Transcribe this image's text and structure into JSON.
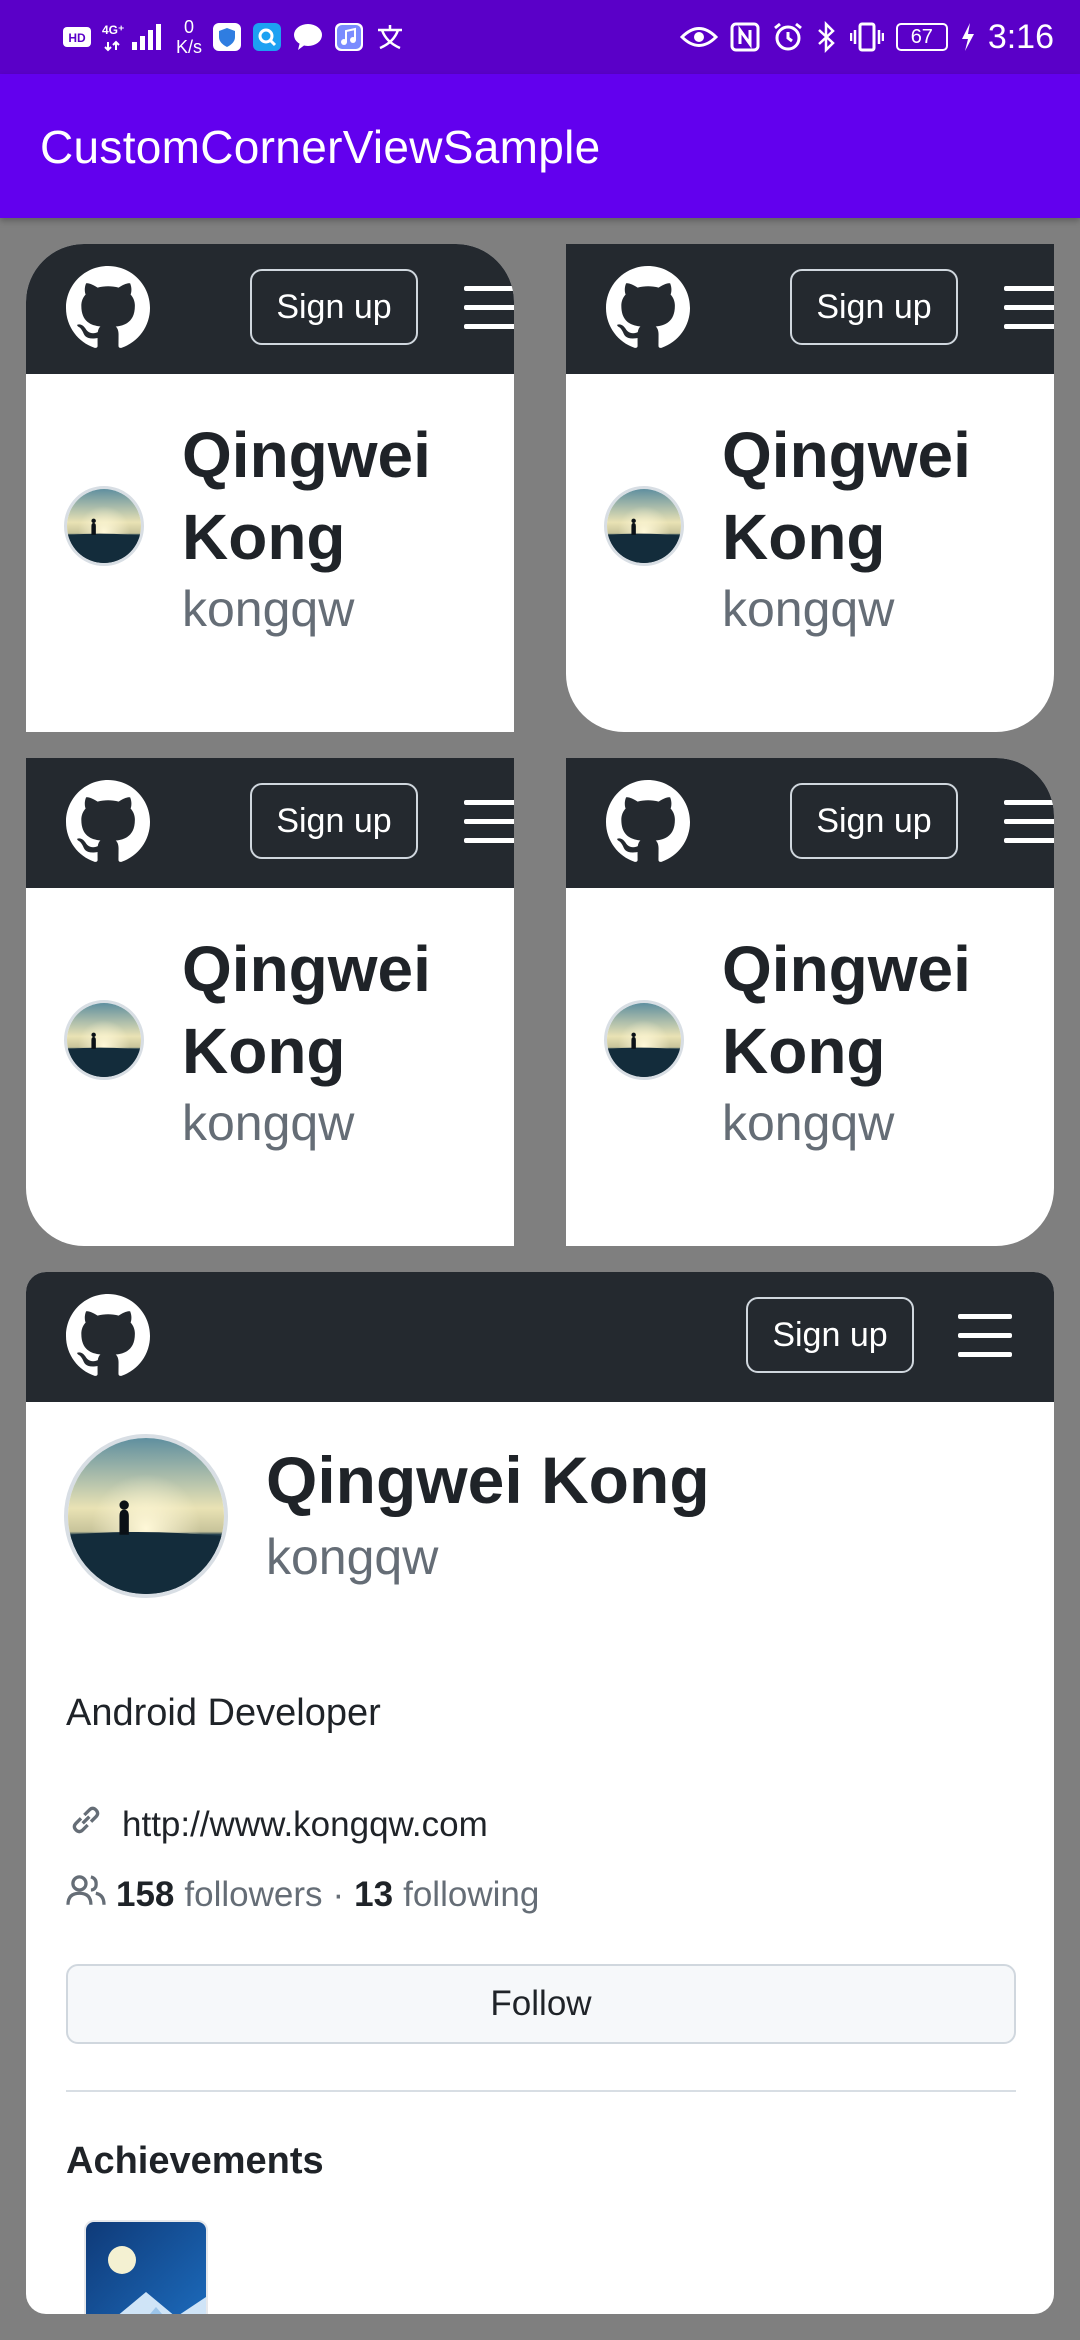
{
  "status_bar": {
    "left_icons": [
      "hd-icon",
      "signal-4g-icon",
      "shield-app-icon",
      "search-app-icon",
      "chat-bubble-icon",
      "music-app-icon",
      "translate-icon"
    ],
    "hd_label": "HD",
    "network_label": "4G⁺",
    "speed_value": "0",
    "speed_unit": "K/s",
    "battery": "67",
    "time": "3:16"
  },
  "app": {
    "title": "CustomCornerViewSample"
  },
  "profile": {
    "name": "Qingwei Kong",
    "name_line1": "Qingwei",
    "name_line2": "Kong",
    "login": "kongqw",
    "signup_label": "Sign up",
    "bio": "Android Developer",
    "website": "http://www.kongqw.com",
    "followers_count": "158",
    "followers_label": "followers",
    "separator": "·",
    "following_count": "13",
    "following_label": "following",
    "follow_label": "Follow",
    "achievements_title": "Achievements"
  },
  "colors": {
    "status_bar": "#5a00c8",
    "app_bar": "#6200ee",
    "background": "#7f7f7f",
    "card_header": "#24292f",
    "text_primary": "#1f2328",
    "text_secondary": "#656d76"
  }
}
